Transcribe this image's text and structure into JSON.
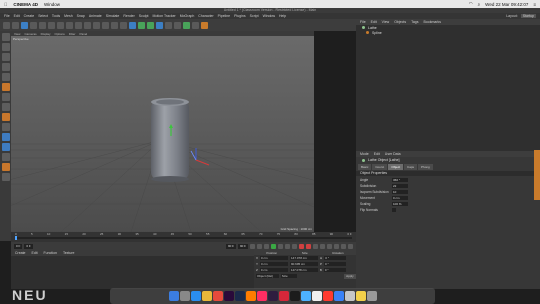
{
  "macbar": {
    "app": "CINEMA 4D",
    "menu": "Window",
    "clock": "Wed 22 Mar  09:42:07"
  },
  "window": {
    "title": "Untitled 1 * (Classroom Version - Restricted License) - Main"
  },
  "menubar": {
    "items": [
      "File",
      "Edit",
      "Create",
      "Select",
      "Tools",
      "Mesh",
      "Snap",
      "Animate",
      "Simulate",
      "Render",
      "Sculpt",
      "Motion Tracker",
      "MoGraph",
      "Character",
      "Pipeline",
      "Plugins",
      "Script",
      "Window",
      "Help"
    ],
    "layout_label": "Layout:",
    "layout_value": "Startup"
  },
  "viewport": {
    "menu": [
      "View",
      "Cameras",
      "Display",
      "Options",
      "Filter",
      "Panel"
    ],
    "label": "Perspective",
    "status": "Grid Spacing : 1000 cm"
  },
  "object_manager": {
    "menu": [
      "File",
      "Edit",
      "View",
      "Objects",
      "Tags",
      "Bookmarks"
    ],
    "objects": [
      "Lathe",
      "Spline"
    ]
  },
  "attributes": {
    "menu": [
      "Mode",
      "Edit",
      "User Data"
    ],
    "object_label": "Lathe Object [Lathe]",
    "tabs": [
      "Basic",
      "Coord.",
      "Object",
      "Caps",
      "Phong"
    ],
    "active_tab": "Object",
    "section": "Object Properties",
    "props": [
      {
        "label": "Angle",
        "value": "360 °"
      },
      {
        "label": "Subdivision",
        "value": "22"
      },
      {
        "label": "Isoparm Subdivision",
        "value": "10"
      },
      {
        "label": "Movement",
        "value": "0 cm"
      },
      {
        "label": "Scaling",
        "value": "100 %"
      },
      {
        "label": "Flip Normals",
        "value": ""
      }
    ]
  },
  "timeline": {
    "ticks": [
      "0",
      "5",
      "10",
      "15",
      "20",
      "25",
      "30",
      "35",
      "40",
      "45",
      "50",
      "55",
      "60",
      "65",
      "70",
      "75",
      "80",
      "85",
      "90"
    ],
    "end_frame": "0 F"
  },
  "playbar": {
    "start": "0 F",
    "current": "0 F",
    "end": "90 F",
    "max": "90 F"
  },
  "materials": {
    "menu": [
      "Create",
      "Edit",
      "Function",
      "Texture"
    ]
  },
  "coordinates": {
    "headers": [
      "Position",
      "Size",
      "Rotation"
    ],
    "rows": [
      {
        "axis": "X",
        "pos": "0 cm",
        "size": "147.078 cm",
        "rot_label": "H",
        "rot": "0 °"
      },
      {
        "axis": "Y",
        "pos": "0 cm",
        "size": "90.695 cm",
        "rot_label": "P",
        "rot": "0 °"
      },
      {
        "axis": "Z",
        "pos": "0 cm",
        "size": "147.078 cm",
        "rot_label": "B",
        "rot": "0 °"
      }
    ],
    "mode": "Object (Rel)",
    "size_mode": "Size",
    "apply": "Apply"
  },
  "watermark": "NEU",
  "colors": {
    "accent": "#c97b2b",
    "viewport_bg": "#575757",
    "can": "#7d8088"
  }
}
